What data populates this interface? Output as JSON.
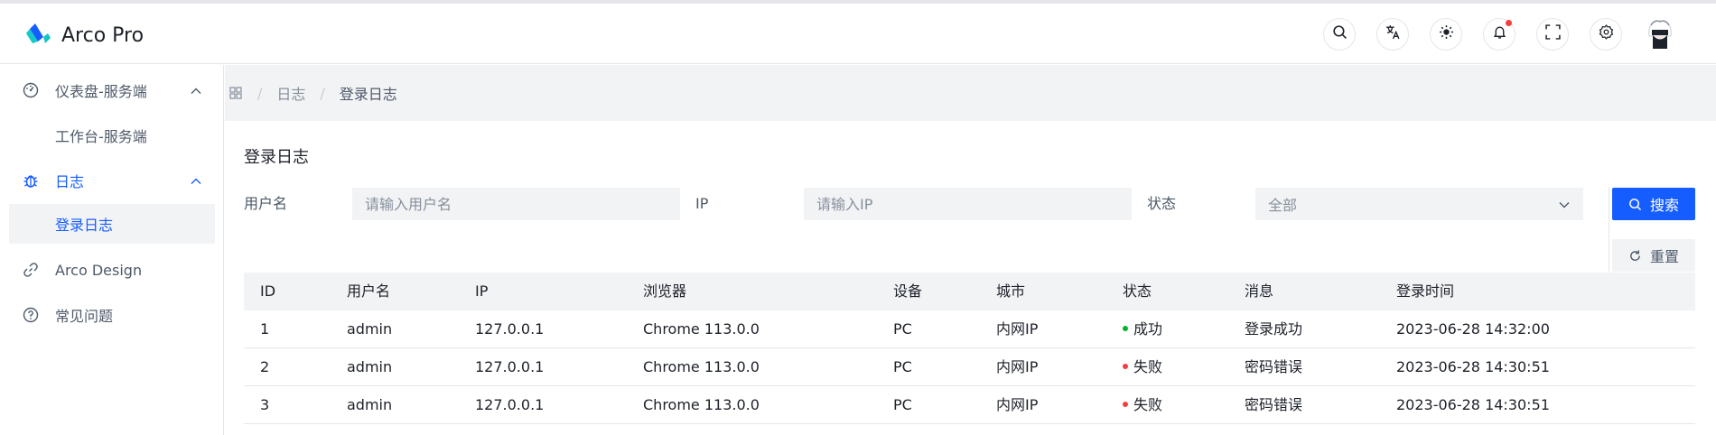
{
  "app": {
    "title": "Arco Pro"
  },
  "colors": {
    "primary": "#165dff",
    "success": "#00b42a",
    "danger": "#f53f3f",
    "notification": "#f53f3f"
  },
  "navbar": {
    "icons": [
      "search-icon",
      "translate-icon",
      "theme-icon",
      "bell-icon",
      "fullscreen-icon",
      "settings-icon"
    ],
    "has_notification": true
  },
  "sidebar": {
    "items": [
      {
        "label": "仪表盘-服务端",
        "icon": "dashboard-icon",
        "expanded": true
      },
      {
        "label": "工作台-服务端",
        "sub": true
      },
      {
        "label": "日志",
        "icon": "bug-icon",
        "expanded": true,
        "active": true
      },
      {
        "label": "登录日志",
        "sub": true,
        "selected": true
      },
      {
        "label": "Arco Design",
        "icon": "link-icon"
      },
      {
        "label": "常见问题",
        "icon": "question-icon"
      }
    ]
  },
  "breadcrumb": {
    "items": [
      "日志",
      "登录日志"
    ]
  },
  "page": {
    "title": "登录日志",
    "filters": {
      "username_label": "用户名",
      "username_placeholder": "请输入用户名",
      "ip_label": "IP",
      "ip_placeholder": "请输入IP",
      "status_label": "状态",
      "status_value": "全部"
    },
    "search_button": "搜索",
    "reset_button": "重置"
  },
  "table": {
    "columns": [
      "ID",
      "用户名",
      "IP",
      "浏览器",
      "设备",
      "城市",
      "状态",
      "消息",
      "登录时间"
    ],
    "rows": [
      {
        "id": "1",
        "username": "admin",
        "ip": "127.0.0.1",
        "browser": "Chrome 113.0.0",
        "device": "PC",
        "city": "内网IP",
        "status": "成功",
        "status_type": "success",
        "message": "登录成功",
        "time": "2023-06-28 14:32:00"
      },
      {
        "id": "2",
        "username": "admin",
        "ip": "127.0.0.1",
        "browser": "Chrome 113.0.0",
        "device": "PC",
        "city": "内网IP",
        "status": "失败",
        "status_type": "danger",
        "message": "密码错误",
        "time": "2023-06-28 14:30:51"
      },
      {
        "id": "3",
        "username": "admin",
        "ip": "127.0.0.1",
        "browser": "Chrome 113.0.0",
        "device": "PC",
        "city": "内网IP",
        "status": "失败",
        "status_type": "danger",
        "message": "密码错误",
        "time": "2023-06-28 14:30:51"
      }
    ]
  }
}
